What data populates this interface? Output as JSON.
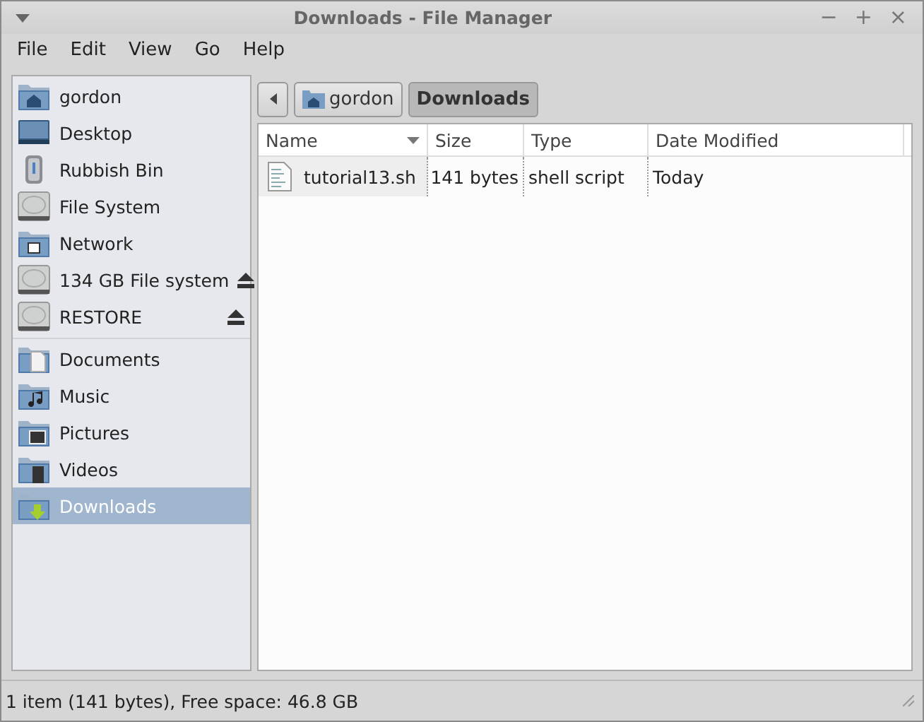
{
  "window": {
    "title": "Downloads - File Manager",
    "controls": [
      "−",
      "+",
      "×"
    ]
  },
  "menu": [
    "File",
    "Edit",
    "View",
    "Go",
    "Help"
  ],
  "sidebar": {
    "sections": [
      {
        "items": [
          {
            "label": "gordon",
            "kind": "home",
            "eject": false,
            "selected": false
          },
          {
            "label": "Desktop",
            "kind": "desktop",
            "eject": false,
            "selected": false
          },
          {
            "label": "Rubbish Bin",
            "kind": "trash",
            "eject": false,
            "selected": false
          },
          {
            "label": "File System",
            "kind": "drive",
            "eject": false,
            "selected": false
          },
          {
            "label": "Network",
            "kind": "network",
            "eject": false,
            "selected": false
          },
          {
            "label": "134 GB File system",
            "kind": "drive",
            "eject": true,
            "selected": false
          },
          {
            "label": "RESTORE",
            "kind": "drive",
            "eject": true,
            "selected": false
          }
        ]
      },
      {
        "items": [
          {
            "label": "Documents",
            "kind": "documents",
            "eject": false,
            "selected": false
          },
          {
            "label": "Music",
            "kind": "music",
            "eject": false,
            "selected": false
          },
          {
            "label": "Pictures",
            "kind": "pictures",
            "eject": false,
            "selected": false
          },
          {
            "label": "Videos",
            "kind": "videos",
            "eject": false,
            "selected": false
          },
          {
            "label": "Downloads",
            "kind": "downloads",
            "eject": false,
            "selected": true
          }
        ]
      }
    ]
  },
  "path": [
    {
      "label": "gordon",
      "kind": "home",
      "selected": false
    },
    {
      "label": "Downloads",
      "kind": "plain",
      "selected": true
    }
  ],
  "table": {
    "columns": [
      {
        "label": "Name",
        "sorted": true
      },
      {
        "label": "Size",
        "sorted": false
      },
      {
        "label": "Type",
        "sorted": false
      },
      {
        "label": "Date Modified",
        "sorted": false
      }
    ],
    "rows": [
      {
        "name": "tutorial13.sh",
        "size": "141 bytes",
        "type": "shell script",
        "modified": "Today",
        "selected": false
      }
    ]
  },
  "status_bar": "1 item (141 bytes), Free space: 46.8 GB"
}
